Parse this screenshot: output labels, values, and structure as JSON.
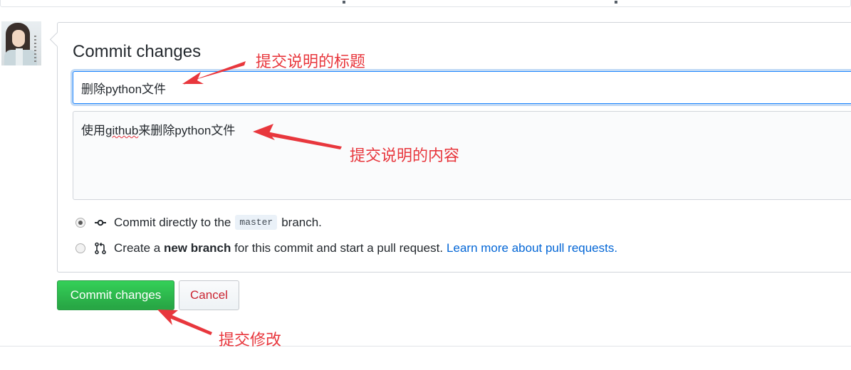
{
  "form": {
    "title": "Commit changes",
    "summary_value": "删除python文件",
    "description_prefix": "使用",
    "description_wavy": "github",
    "description_suffix": "来删除python文件"
  },
  "options": {
    "direct": {
      "prefix": "Commit directly to the",
      "branch": "master",
      "suffix": "branch.",
      "checked": true
    },
    "new_branch": {
      "prefix": "Create a",
      "bold": "new branch",
      "middle": "for this commit and start a pull request.",
      "link": "Learn more about pull requests.",
      "checked": false
    }
  },
  "buttons": {
    "commit": "Commit changes",
    "cancel": "Cancel"
  },
  "annotations": {
    "title_note": "提交说明的标题",
    "content_note": "提交说明的内容",
    "submit_note": "提交修改",
    "color": "#e8373d"
  },
  "icons": [
    "commit-icon",
    "pull-request-icon"
  ],
  "colors": {
    "primary_button": "#28a745",
    "cancel_text": "#cb2431",
    "link": "#0366d6",
    "focus_border": "#2188ff"
  }
}
